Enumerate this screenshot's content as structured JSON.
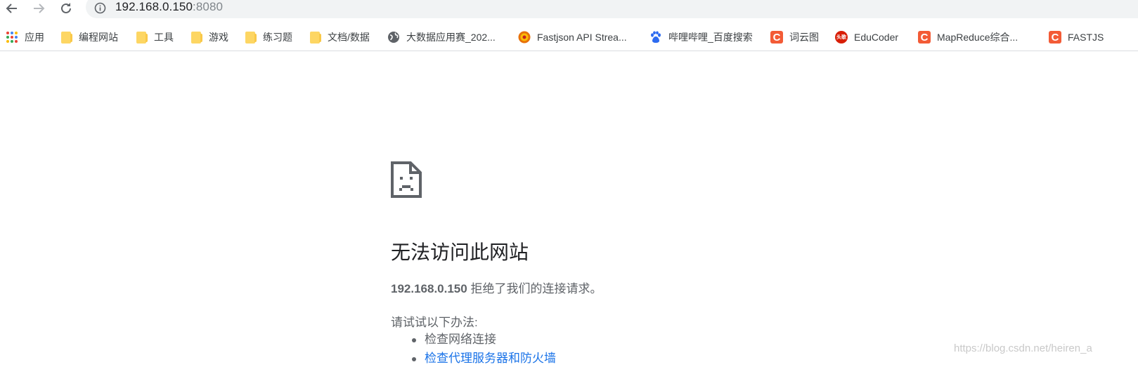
{
  "address_bar": {
    "host": "192.168.0.150",
    "port": ":8080"
  },
  "bookmarks": [
    {
      "label": "应用",
      "icon": "apps-grid-icon"
    },
    {
      "label": "编程网站",
      "icon": "folder-icon"
    },
    {
      "label": "工具",
      "icon": "folder-icon"
    },
    {
      "label": "游戏",
      "icon": "folder-icon"
    },
    {
      "label": "练习题",
      "icon": "folder-icon"
    },
    {
      "label": "文档/数据",
      "icon": "folder-icon"
    },
    {
      "label": "大数据应用赛_202...",
      "icon": "globe-icon"
    },
    {
      "label": "Fastjson API Strea...",
      "icon": "fastjson-icon"
    },
    {
      "label": "哔哩哔哩_百度搜索",
      "icon": "baidu-paw-icon"
    },
    {
      "label": "词云图",
      "icon": "csdn-c-icon"
    },
    {
      "label": "EduCoder",
      "icon": "toutiao-icon",
      "icon_text": "头歌"
    },
    {
      "label": "MapReduce综合...",
      "icon": "csdn-c-icon"
    },
    {
      "label": "FASTJS",
      "icon": "csdn-c-icon"
    }
  ],
  "error": {
    "title": "无法访问此网站",
    "host": "192.168.0.150",
    "message": "拒绝了我们的连接请求。",
    "try_label": "请试试以下办法:",
    "suggestions": [
      "检查网络连接",
      "检查代理服务器和防火墙"
    ]
  },
  "watermark": "https://blog.csdn.net/heiren_a",
  "colors": {
    "link": "#1a73e8",
    "folder": "#fdd663",
    "csdn": "#f35b36",
    "omnibox_bg": "#f1f3f4"
  }
}
